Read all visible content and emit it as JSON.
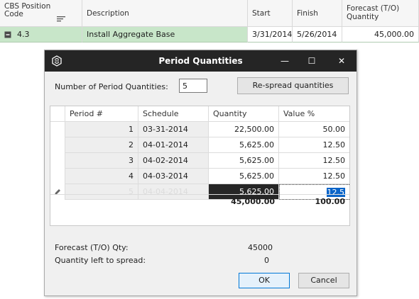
{
  "background_grid": {
    "headers": {
      "cbs_position_code": "CBS Position Code",
      "description": "Description",
      "start": "Start",
      "finish": "Finish",
      "forecast": "Forecast (T/O) Quantity"
    },
    "row": {
      "code": "4.3",
      "description": "Install Aggregate Base",
      "start": "3/31/2014",
      "finish": "5/26/2014",
      "forecast": "45,000.00"
    }
  },
  "dialog": {
    "title": "Period Quantities",
    "minimize_glyph": "—",
    "maximize_glyph": "☐",
    "close_glyph": "✕",
    "num_periods_label": "Number of Period Quantities:",
    "num_periods_value": "5",
    "respread_label": "Re-spread quantities",
    "columns": {
      "period": "Period #",
      "schedule": "Schedule",
      "quantity": "Quantity",
      "value_pct": "Value %"
    },
    "rows": [
      {
        "period": "1",
        "schedule": "03-31-2014",
        "quantity": "22,500.00",
        "value_pct": "50.00"
      },
      {
        "period": "2",
        "schedule": "04-01-2014",
        "quantity": "5,625.00",
        "value_pct": "12.50"
      },
      {
        "period": "3",
        "schedule": "04-02-2014",
        "quantity": "5,625.00",
        "value_pct": "12.50"
      },
      {
        "period": "4",
        "schedule": "04-03-2014",
        "quantity": "5,625.00",
        "value_pct": "12.50"
      }
    ],
    "active_row": {
      "period": "5",
      "schedule": "04-04-2014",
      "quantity": "5,625.00",
      "value_pct_editing": "12.5"
    },
    "totals": {
      "quantity": "45,000.00",
      "value_pct": "100.00"
    },
    "forecast_label": "Forecast (T/O) Qty:",
    "forecast_value": "45000",
    "left_label": "Quantity left to spread:",
    "left_value": "0",
    "ok_label": "OK",
    "cancel_label": "Cancel"
  },
  "colors": {
    "row_highlight": "#c8e6c9",
    "titlebar": "#252525",
    "selected_cell": "#262626",
    "text_selection": "#0a64c8"
  },
  "icons": [
    "sort-lines-icon",
    "expand-minus-icon",
    "app-logo-icon",
    "edit-pencil-icon"
  ]
}
